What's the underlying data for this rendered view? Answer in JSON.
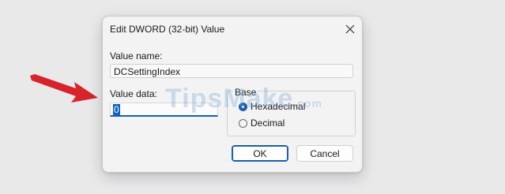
{
  "dialog": {
    "title": "Edit DWORD (32-bit) Value",
    "close_icon": "close-icon",
    "value_name_label": "Value name:",
    "value_name": "DCSettingIndex",
    "value_data_label": "Value data:",
    "value_data": "0",
    "base": {
      "label": "Base",
      "options": [
        {
          "label": "Hexadecimal",
          "selected": true
        },
        {
          "label": "Decimal",
          "selected": false
        }
      ]
    },
    "ok_label": "OK",
    "cancel_label": "Cancel"
  },
  "annotation": {
    "arrow_icon": "red-arrow-icon",
    "arrow_color": "#d9232a"
  },
  "watermark": {
    "text": "TipsMake",
    "suffix": ".com"
  },
  "colors": {
    "accent": "#1a5fa8",
    "selection": "#0a64c8",
    "dialog_bg": "#f3f3f3",
    "page_bg": "#e9e9ea"
  }
}
